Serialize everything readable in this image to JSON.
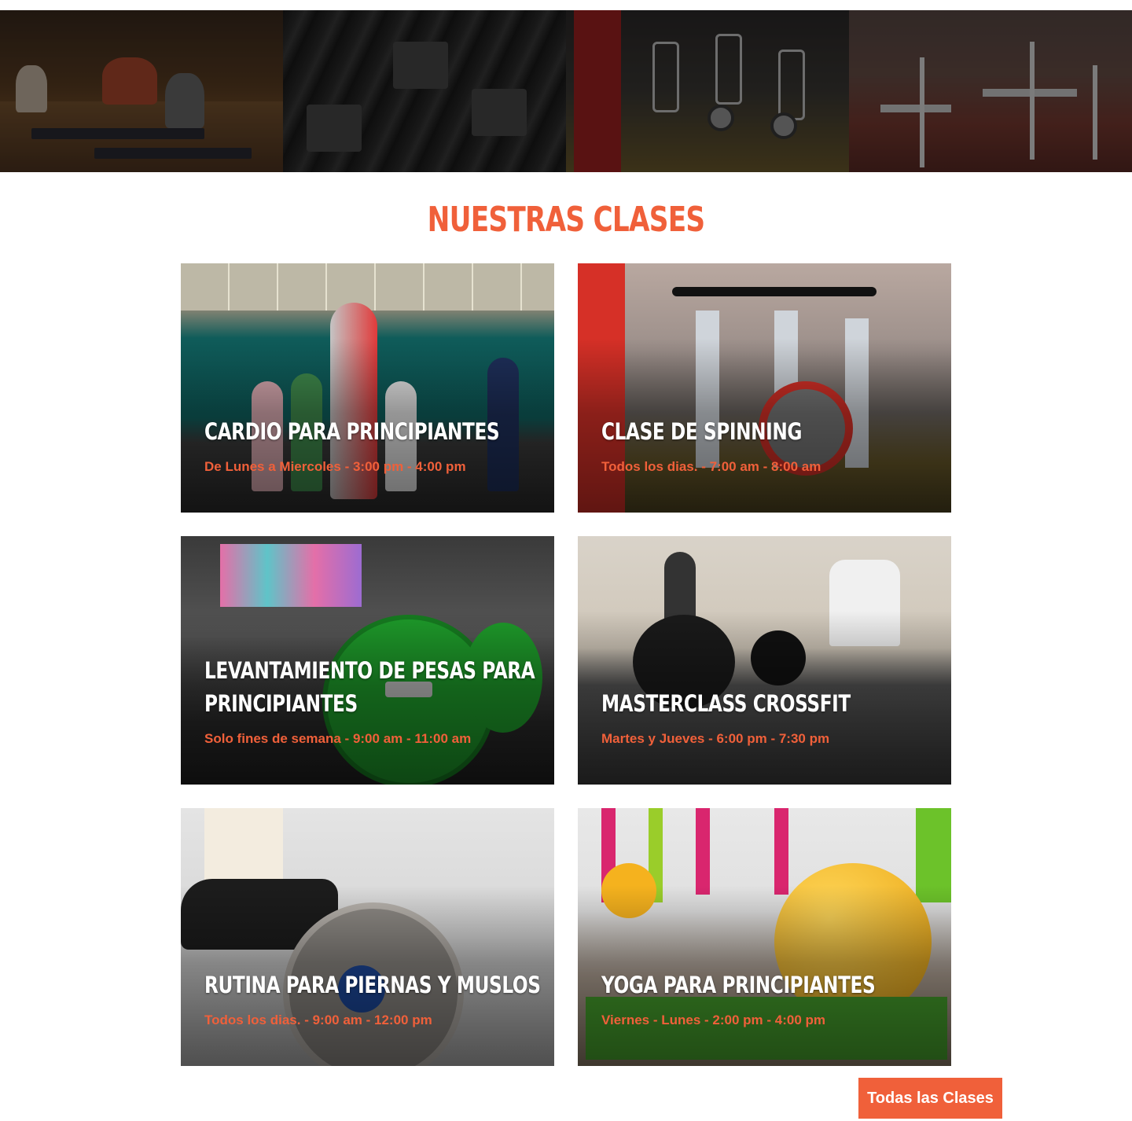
{
  "section": {
    "title": "NUESTRAS CLASES"
  },
  "classes": [
    {
      "title": "CARDIO PARA PRINCIPIANTES",
      "schedule": "De Lunes a Miercoles - 3:00 pm - 4:00 pm"
    },
    {
      "title": "CLASE DE SPINNING",
      "schedule": "Todos los dias. - 7:00 am - 8:00 am"
    },
    {
      "title": "LEVANTAMIENTO DE PESAS PARA PRINCIPIANTES",
      "schedule": "Solo fines de semana - 9:00 am - 11:00 am"
    },
    {
      "title": "MASTERCLASS CROSSFIT",
      "schedule": "Martes y Jueves - 6:00 pm - 7:30 pm"
    },
    {
      "title": "RUTINA PARA PIERNAS Y MUSLOS",
      "schedule": "Todos los dias. - 9:00 am - 12:00 pm"
    },
    {
      "title": "YOGA PARA PRINCIPIANTES",
      "schedule": "Viernes - Lunes - 2:00 pm - 4:00 pm"
    }
  ],
  "cta": {
    "all_classes_label": "Todas las Clases"
  },
  "colors": {
    "accent": "#f0603a",
    "text_on_photo": "#ffffff"
  }
}
